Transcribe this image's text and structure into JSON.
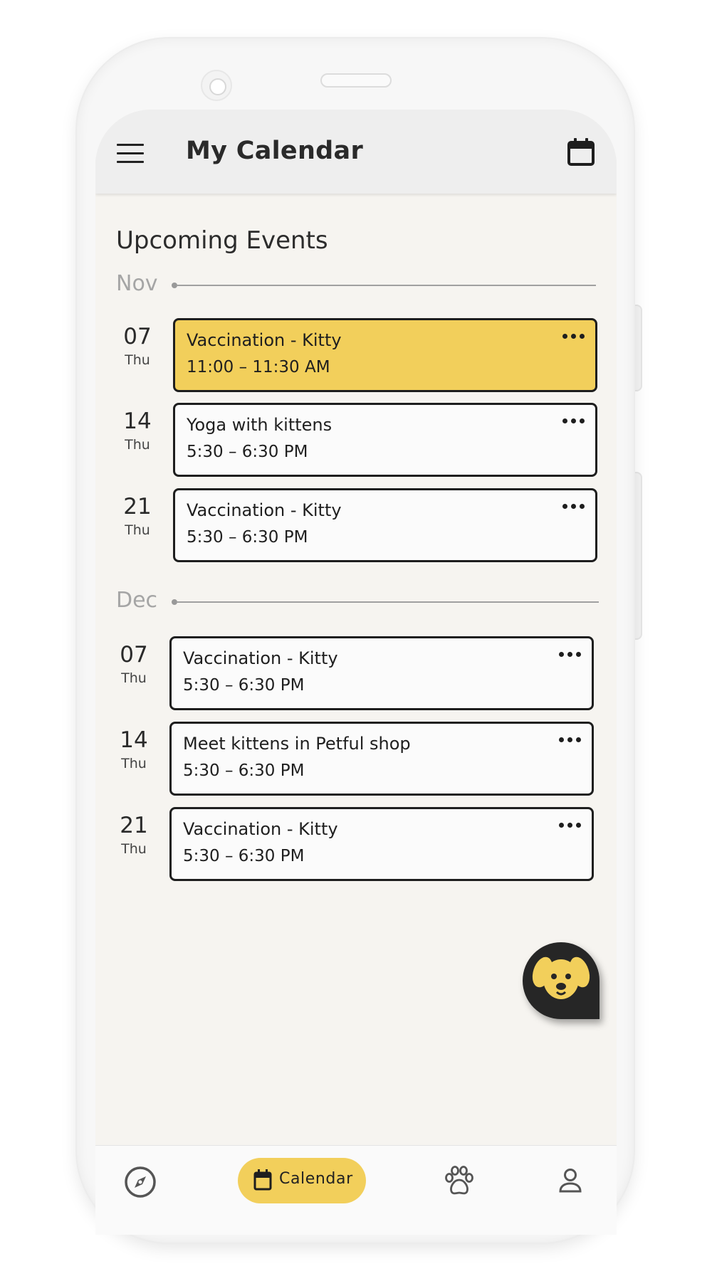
{
  "app": {
    "title": "My Calendar"
  },
  "upcoming": {
    "heading": "Upcoming Events",
    "months": [
      {
        "name": "Nov",
        "events": [
          {
            "day_num": "07",
            "day_name": "Thu",
            "title": "Vaccination - Kitty",
            "time": "11:00 – 11:30 AM",
            "highlighted": true
          },
          {
            "day_num": "14",
            "day_name": "Thu",
            "title": "Yoga with kittens",
            "time": "5:30 – 6:30 PM",
            "highlighted": false
          },
          {
            "day_num": "21",
            "day_name": "Thu",
            "title": "Vaccination - Kitty",
            "time": "5:30 – 6:30 PM",
            "highlighted": false
          }
        ]
      },
      {
        "name": "Dec",
        "events": [
          {
            "day_num": "07",
            "day_name": "Thu",
            "title": "Vaccination - Kitty",
            "time": "5:30 – 6:30 PM",
            "highlighted": false
          },
          {
            "day_num": "14",
            "day_name": "Thu",
            "title": "Meet kittens in Petful shop",
            "time": "5:30 – 6:30 PM",
            "highlighted": false
          },
          {
            "day_num": "21",
            "day_name": "Thu",
            "title": "Vaccination - Kitty",
            "time": "5:30 – 6:30 PM",
            "highlighted": false
          }
        ]
      }
    ]
  },
  "bottom_nav": {
    "items": [
      {
        "icon": "compass-icon",
        "label": ""
      },
      {
        "icon": "calendar-icon",
        "label": "Calendar",
        "active": true
      },
      {
        "icon": "paw-icon",
        "label": ""
      },
      {
        "icon": "person-icon",
        "label": ""
      }
    ]
  },
  "fab": {
    "icon": "dog-face-icon"
  },
  "colors": {
    "accent": "#f2cf5b",
    "background": "#f6f4f0",
    "dark": "#262626"
  }
}
